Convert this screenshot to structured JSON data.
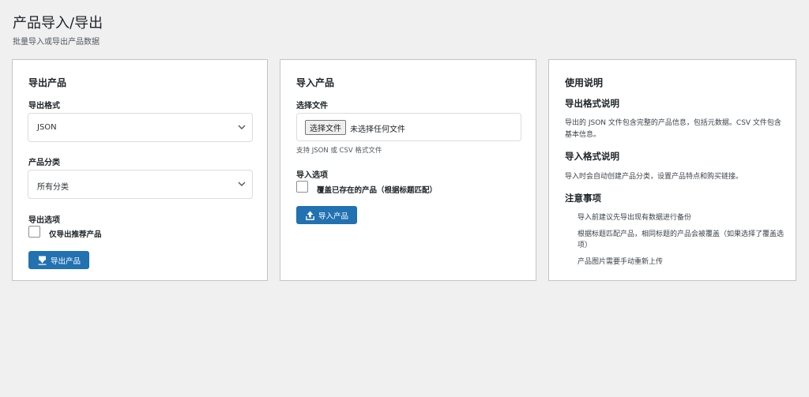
{
  "header": {
    "title": "产品导入/导出",
    "subtitle": "批量导入或导出产品数据"
  },
  "export_card": {
    "title": "导出产品",
    "format_label": "导出格式",
    "format_selected": "JSON",
    "category_label": "产品分类",
    "category_selected": "所有分类",
    "options_label": "导出选项",
    "featured_only_label": "仅导出推荐产品",
    "featured_only_checked": false,
    "button_label": "导出产品"
  },
  "import_card": {
    "title": "导入产品",
    "file_label": "选择文件",
    "file_button": "选择文件",
    "file_status": "未选择任何文件",
    "file_hint": "支持 JSON 或 CSV 格式文件",
    "options_label": "导入选项",
    "overwrite_label": "覆盖已存在的产品（根据标题匹配）",
    "overwrite_checked": false,
    "button_label": "导入产品"
  },
  "help_card": {
    "title": "使用说明",
    "export_heading": "导出格式说明",
    "export_text": "导出的 JSON 文件包含完整的产品信息，包括元数据。CSV 文件包含基本信息。",
    "import_heading": "导入格式说明",
    "import_text": "导入时会自动创建产品分类，设置产品特点和购买链接。",
    "notes_heading": "注意事项",
    "notes": [
      "导入前建议先导出现有数据进行备份",
      "根据标题匹配产品，相同标题的产品会被覆盖（如果选择了覆盖选项）",
      "产品图片需要手动重新上传"
    ]
  },
  "colors": {
    "primary": "#2271b1",
    "background": "#f0f0f1",
    "card_border": "#c3c4c7"
  },
  "icons": {
    "chevron": "chevron-down-icon",
    "export": "download-icon",
    "import": "upload-icon"
  }
}
